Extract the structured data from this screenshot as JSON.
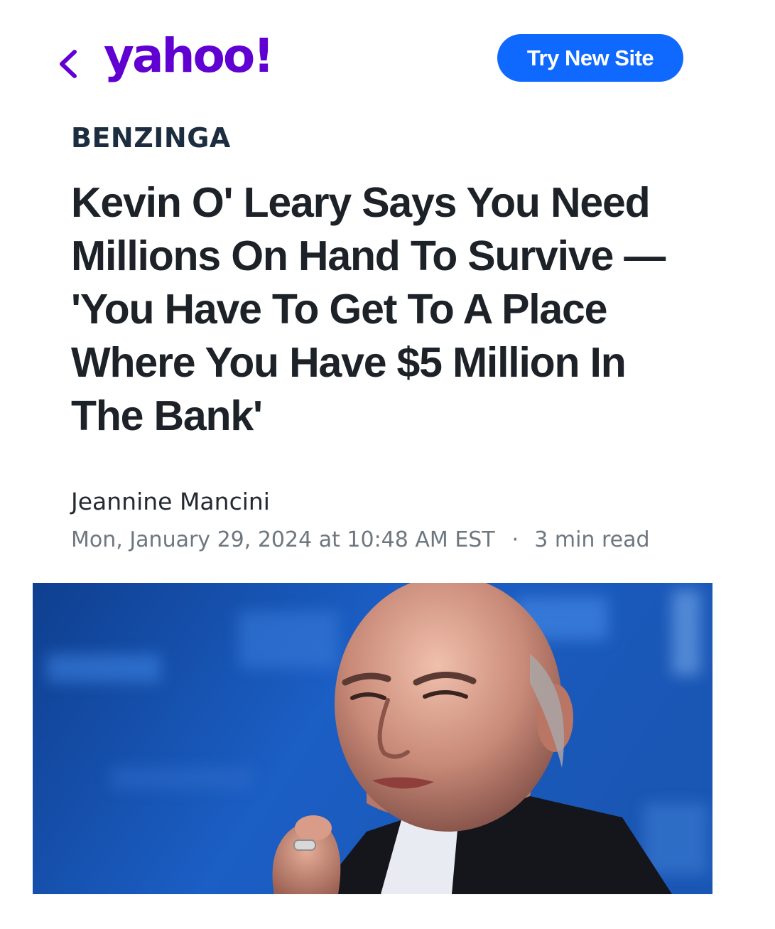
{
  "header": {
    "back_icon": "chevron-left-icon",
    "logo_text": "yahoo!",
    "try_button_label": "Try New Site",
    "brand_color": "#6001d2",
    "button_color": "#0f69ff"
  },
  "article": {
    "provider": "BENZINGA",
    "headline": "Kevin O' Leary Says You Need Millions On Hand To Survive — 'You Have To Get To A Place Where You Have $5 Million In The Bank'",
    "author": "Jeannine Mancini",
    "timestamp": "Mon, January 29, 2024 at 10:48 AM EST",
    "separator": "·",
    "read_time": "3 min read"
  },
  "image": {
    "subject": "photo-of-speaker"
  }
}
